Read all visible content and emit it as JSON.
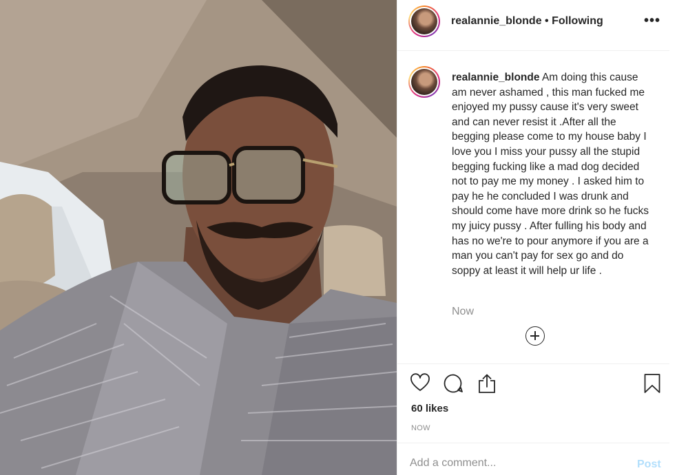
{
  "post": {
    "username": "realannie_blonde",
    "separator": "•",
    "follow_status": "Following",
    "more_label": "•••",
    "caption_username": "realannie_blonde",
    "caption_text": "Am doing this cause am never ashamed , this man fucked me enjoyed my pussy cause it's very sweet and can never resist it .After all the begging please come to my house baby I love you I miss your pussy all the stupid begging fucking like a mad dog decided not to pay me my money . I asked him to pay he he concluded I was drunk and should come have more drink so he fucks my juicy pussy . After fulling his body and has no we're to pour anymore if you are a man you can't pay for sex go and do soppy at least it will help ur life .",
    "caption_time": "Now",
    "likes": "60 likes",
    "post_time": "NOW"
  },
  "comment": {
    "placeholder": "Add a comment...",
    "post_label": "Post"
  },
  "icons": {
    "like": "heart-icon",
    "comment": "comment-bubble-icon",
    "share": "share-icon",
    "save": "bookmark-icon",
    "load_more": "plus-circle-icon",
    "more": "ellipsis-icon"
  },
  "colors": {
    "text": "#262626",
    "muted": "#8e8e8e",
    "post_disabled": "#b2dffc",
    "border": "#efefef"
  }
}
